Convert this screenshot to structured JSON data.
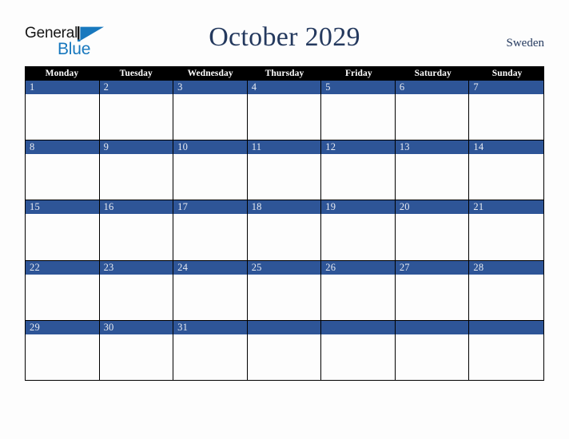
{
  "brand": {
    "word_one": "General",
    "word_two": "Blue",
    "triangle_icon": "blue-triangle-logo-mark",
    "dark_color": "#161616",
    "blue_color": "#1878be"
  },
  "header": {
    "title": "October 2029",
    "country": "Sweden",
    "title_color": "#24395e"
  },
  "calendar": {
    "month": "October",
    "year": "2029",
    "weekday_headers": [
      "Monday",
      "Tuesday",
      "Wednesday",
      "Thursday",
      "Friday",
      "Saturday",
      "Sunday"
    ],
    "header_bg_color": "#000000",
    "header_text_color": "#ffffff",
    "date_band_color": "#2e5597",
    "date_text_color": "#e8ebf2",
    "grid_line_color": "#000000",
    "cell_bg_color": "#fdfdfd",
    "weeks": [
      {
        "days": [
          {
            "num": "1"
          },
          {
            "num": "2"
          },
          {
            "num": "3"
          },
          {
            "num": "4"
          },
          {
            "num": "5"
          },
          {
            "num": "6"
          },
          {
            "num": "7"
          }
        ]
      },
      {
        "days": [
          {
            "num": "8"
          },
          {
            "num": "9"
          },
          {
            "num": "10"
          },
          {
            "num": "11"
          },
          {
            "num": "12"
          },
          {
            "num": "13"
          },
          {
            "num": "14"
          }
        ]
      },
      {
        "days": [
          {
            "num": "15"
          },
          {
            "num": "16"
          },
          {
            "num": "17"
          },
          {
            "num": "18"
          },
          {
            "num": "19"
          },
          {
            "num": "20"
          },
          {
            "num": "21"
          }
        ]
      },
      {
        "days": [
          {
            "num": "22"
          },
          {
            "num": "23"
          },
          {
            "num": "24"
          },
          {
            "num": "25"
          },
          {
            "num": "26"
          },
          {
            "num": "27"
          },
          {
            "num": "28"
          }
        ]
      },
      {
        "days": [
          {
            "num": "29"
          },
          {
            "num": "30"
          },
          {
            "num": "31"
          },
          {
            "num": ""
          },
          {
            "num": ""
          },
          {
            "num": ""
          },
          {
            "num": ""
          }
        ]
      }
    ]
  }
}
